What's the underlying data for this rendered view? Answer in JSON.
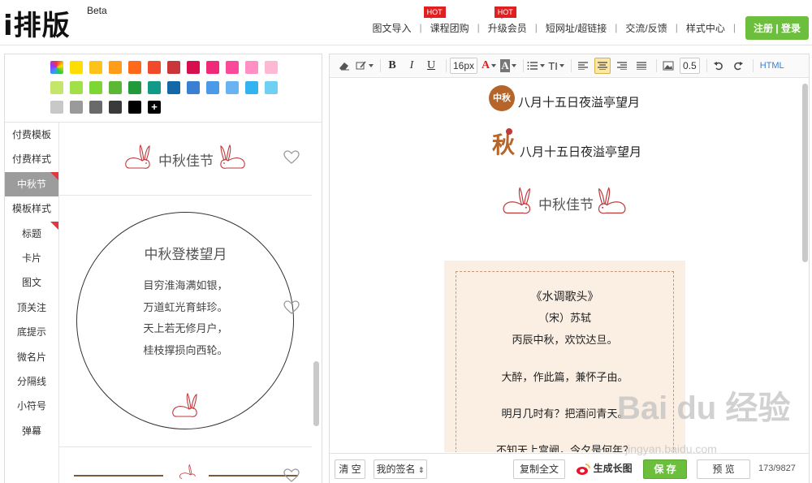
{
  "brand": {
    "logo_text": "i排版",
    "beta_label": "Beta"
  },
  "nav": {
    "items": [
      {
        "label": "图文导入",
        "hot": ""
      },
      {
        "label": "课程团购",
        "hot": "HOT"
      },
      {
        "label": "升级会员",
        "hot": "HOT"
      },
      {
        "label": "短网址/超链接",
        "hot": ""
      },
      {
        "label": "交流/反馈",
        "hot": ""
      },
      {
        "label": "样式中心",
        "hot": ""
      }
    ],
    "login_label": "注册 | 登录"
  },
  "palette": {
    "row1": [
      "rainbow",
      "#ffdd00",
      "#ffc21a",
      "#ff9c1a",
      "#ff6a1a",
      "#f04a2b",
      "#c8363a",
      "#d60f4f",
      "#ef2b79",
      "#fc4a9b",
      "#ff8fc4",
      "#ffb8d4"
    ],
    "row2": [
      "#c5e66a",
      "#a2e04a",
      "#7dd633",
      "#5bb835",
      "#229a3c",
      "#139a86",
      "#1468a8",
      "#3a7fd4",
      "#4a9ae8",
      "#6ab3f3",
      "#31b4f0",
      "#6fd0f5"
    ],
    "row3": [
      "#c8c8c8",
      "#9a9a9a",
      "#6a6a6a",
      "#3a3a3a",
      "#000000",
      "add"
    ],
    "add_label": "+"
  },
  "categories": [
    {
      "label": "付费模板",
      "active": false,
      "corner": false
    },
    {
      "label": "付费样式",
      "active": false,
      "corner": false
    },
    {
      "label": "中秋节",
      "active": true,
      "corner": true
    },
    {
      "label": "模板样式",
      "active": false,
      "corner": false
    },
    {
      "label": "标题",
      "active": false,
      "corner": true
    },
    {
      "label": "卡片",
      "active": false,
      "corner": false
    },
    {
      "label": "图文",
      "active": false,
      "corner": false
    },
    {
      "label": "顶关注",
      "active": false,
      "corner": false
    },
    {
      "label": "底提示",
      "active": false,
      "corner": false
    },
    {
      "label": "微名片",
      "active": false,
      "corner": false
    },
    {
      "label": "分隔线",
      "active": false,
      "corner": false
    },
    {
      "label": "小符号",
      "active": false,
      "corner": false
    },
    {
      "label": "弹幕",
      "active": false,
      "corner": false
    }
  ],
  "templates": {
    "card1_title": "中秋佳节",
    "card2_title": "中秋登楼望月",
    "card2_lines": [
      "目穷淮海满如银，",
      "万道虹光育蚌珍。",
      "天上若无修月户，",
      "桂枝撑损向西轮。"
    ]
  },
  "toolbar": {
    "font_size": "16px",
    "line_height": "0.5",
    "html_label": "HTML",
    "bold": "B",
    "italic": "I",
    "underline": "U",
    "font_color": "A",
    "bg_color": "A",
    "text_size": "TI"
  },
  "editor": {
    "line1": "八月十五日夜溢亭望月",
    "line2": "八月十五日夜溢亭望月",
    "badge1": "中秋",
    "badge2": "秋",
    "festival_title": "中秋佳节",
    "poem": {
      "title": "《水调歌头》",
      "author": "（宋）苏轼",
      "lines": [
        "丙辰中秋，欢饮达旦。",
        "大醉，作此篇，兼怀子由。",
        "明月几时有？把酒问青天。",
        "不知天上宫阙，今夕是何年？"
      ]
    }
  },
  "bottom": {
    "clear_label": "清 空",
    "signature_label": "我的签名",
    "copy_label": "复制全文",
    "longimg_label": "生成长图",
    "save_label": "保 存",
    "preview_label": "预 览",
    "counter": "173/9827"
  },
  "watermark": {
    "text": "Bai du 经验",
    "sub": "jingyan.baidu.com"
  }
}
